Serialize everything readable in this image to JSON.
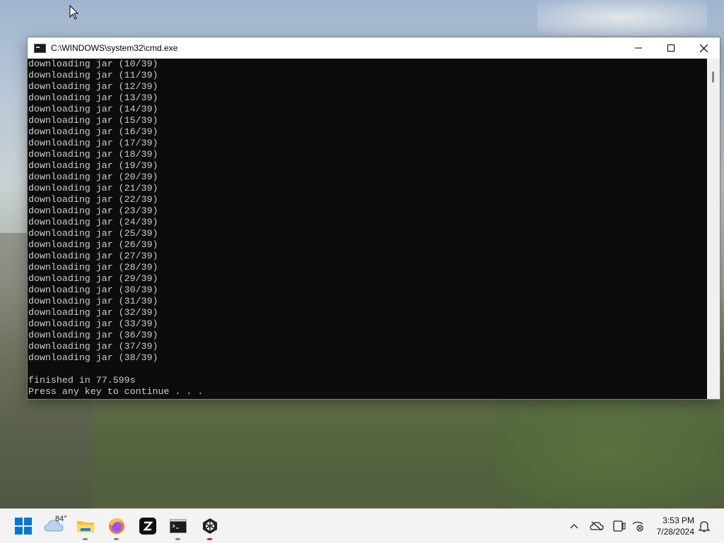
{
  "window": {
    "title": "C:\\WINDOWS\\system32\\cmd.exe"
  },
  "console": {
    "lines": [
      "downloading jar (10/39)",
      "downloading jar (11/39)",
      "downloading jar (12/39)",
      "downloading jar (13/39)",
      "downloading jar (14/39)",
      "downloading jar (15/39)",
      "downloading jar (16/39)",
      "downloading jar (17/39)",
      "downloading jar (18/39)",
      "downloading jar (19/39)",
      "downloading jar (20/39)",
      "downloading jar (21/39)",
      "downloading jar (22/39)",
      "downloading jar (23/39)",
      "downloading jar (24/39)",
      "downloading jar (25/39)",
      "downloading jar (26/39)",
      "downloading jar (27/39)",
      "downloading jar (28/39)",
      "downloading jar (29/39)",
      "downloading jar (30/39)",
      "downloading jar (31/39)",
      "downloading jar (32/39)",
      "downloading jar (33/39)",
      "downloading jar (36/39)",
      "downloading jar (37/39)",
      "downloading jar (38/39)",
      "",
      "finished in 77.599s",
      "Press any key to continue . . ."
    ]
  },
  "taskbar": {
    "weather_temp": "84°",
    "clock_time": "3:53 PM",
    "clock_date": "7/28/2024",
    "items": [
      {
        "name": "start-button",
        "icon": "windows-logo-icon"
      },
      {
        "name": "weather-widget",
        "icon": "cloud-icon"
      },
      {
        "name": "file-explorer",
        "icon": "folder-icon"
      },
      {
        "name": "firefox",
        "icon": "firefox-icon"
      },
      {
        "name": "z-app",
        "icon": "z-icon"
      },
      {
        "name": "terminal",
        "icon": "terminal-icon"
      },
      {
        "name": "unity-app",
        "icon": "unity-icon"
      }
    ]
  },
  "colors": {
    "console_bg": "#0c0c0c",
    "console_text": "#cccccc",
    "taskbar_bg": "#f3f3f3",
    "windows_blue": "#0078d4"
  }
}
